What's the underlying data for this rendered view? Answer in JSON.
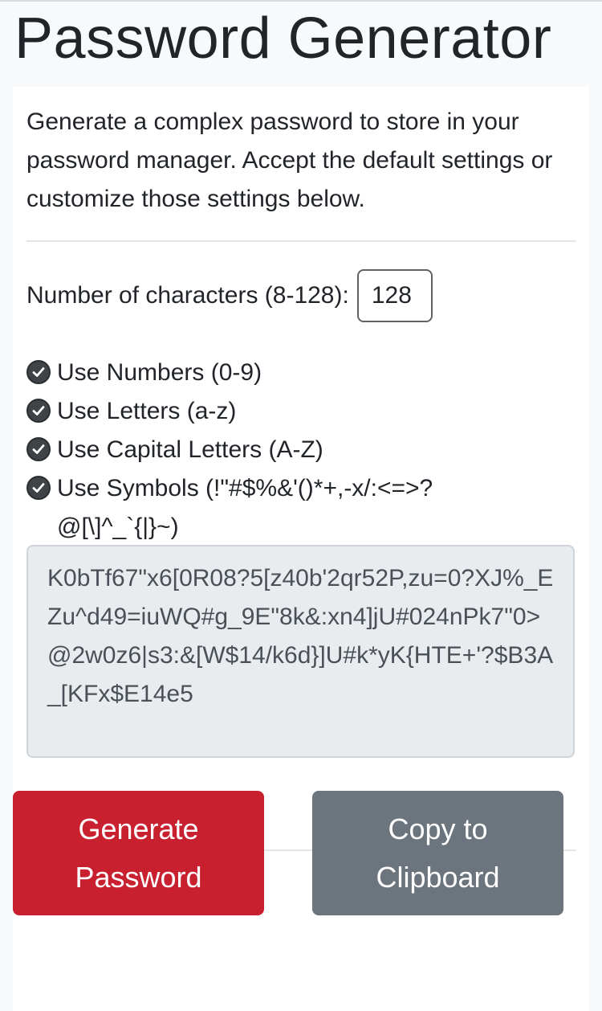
{
  "header": {
    "title": "Password Generator"
  },
  "intro": {
    "text": "Generate a complex password to store in your password manager. Accept the default settings or customize those settings below."
  },
  "length": {
    "label": "Number of characters (8-128):",
    "value": "128"
  },
  "options": [
    {
      "label": "Use Numbers (0-9)",
      "checked": true
    },
    {
      "label": "Use Letters (a-z)",
      "checked": true
    },
    {
      "label": "Use Capital Letters (A-Z)",
      "checked": true
    },
    {
      "label": "Use Symbols (!\"#$%&'()*+,-x/:<=>?",
      "label_line2": "@[\\]^_`{|}~)",
      "checked": true
    }
  ],
  "output": {
    "password": "K0bTf67\"x6[0R08?5[z40b'2qr52P,zu=0?XJ%_EZu^d49=iuWQ#g_9E\"8k&:xn4]jU#024nPk7\"0>@2w0z6|s3:&[W$14/k6d}]U#k*yK{HTE+'?$B3A_[KFx$E14e5"
  },
  "buttons": {
    "generate_label": "Generate Password",
    "copy_label": "Copy to Clipboard"
  },
  "colors": {
    "generate": "#c8202f",
    "copy": "#6c757d",
    "page_bg": "#f8f9fa"
  },
  "icons": {
    "checkbox": "checkbox-checked-icon"
  }
}
